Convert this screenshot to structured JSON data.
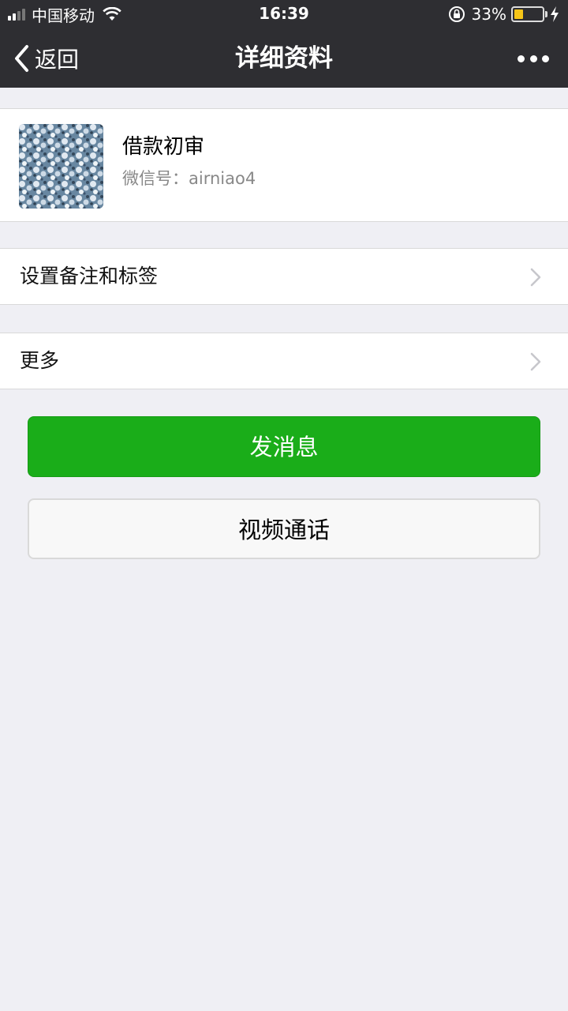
{
  "status_bar": {
    "carrier": "中国移动",
    "time": "16:39",
    "battery_percent_text": "33%",
    "battery_level": 0.33,
    "signal_bars_filled": 2,
    "signal_bars_total": 4,
    "icons": [
      "signal-icon",
      "wifi-icon",
      "rotation-lock-icon",
      "battery-icon",
      "charging-bolt-icon"
    ]
  },
  "nav": {
    "back_label": "返回",
    "title": "详细资料",
    "more_icon": "ellipsis-icon"
  },
  "profile": {
    "name": "借款初审",
    "wechat_id": "微信号：airniao4",
    "avatar_icon": "frost-texture-avatar"
  },
  "rows": {
    "remark_label": "设置备注和标签",
    "more_label": "更多"
  },
  "buttons": {
    "message_label": "发消息",
    "video_call_label": "视频通话"
  },
  "colors": {
    "nav_background": "#2e2e32",
    "page_background": "#efeff4",
    "primary_green": "#1aad19",
    "battery_yellow": "#f5c518"
  }
}
